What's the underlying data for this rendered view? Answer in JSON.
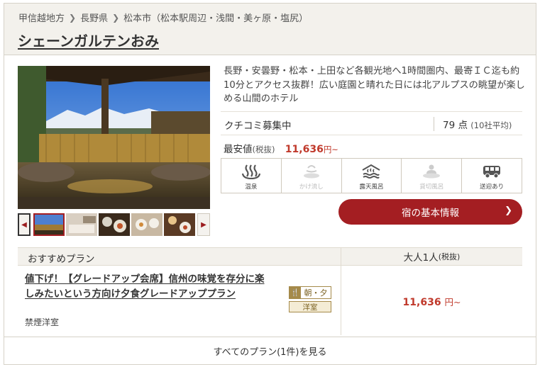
{
  "breadcrumb": {
    "items": [
      "甲信越地方",
      "長野県",
      "松本市（松本駅周辺・浅間・美ヶ原・塩尻）"
    ]
  },
  "hotel": {
    "name": "シェーンガルテンおみ",
    "description": "長野・安曇野・松本・上田など各観光地へ1時間圏内、最寄ＩＣ迄も約10分とアクセス抜群！広い庭園と晴れた日には北アルプスの眺望が楽しめる山間のホテル"
  },
  "review": {
    "label": "クチコミ募集中",
    "score": "79 点",
    "score_note": "(10社平均)"
  },
  "price": {
    "label": "最安値",
    "tax_note": "(税抜)",
    "value": "11,636",
    "unit": "円~"
  },
  "amenities": [
    {
      "label": "温泉",
      "icon": "hot-spring-icon",
      "active": true
    },
    {
      "label": "かけ流し",
      "icon": "flowing-spring-icon",
      "active": false
    },
    {
      "label": "露天風呂",
      "icon": "open-air-bath-icon",
      "active": true
    },
    {
      "label": "貸切風呂",
      "icon": "private-bath-icon",
      "active": false
    },
    {
      "label": "送迎あり",
      "icon": "shuttle-van-icon",
      "active": true
    }
  ],
  "info_button": {
    "label": "宿の基本情報"
  },
  "plans_header": {
    "left": "おすすめプラン",
    "right": "大人1人",
    "right_note": "(税抜)"
  },
  "plan": {
    "name": "値下げ！【グレードアップ会席】信州の味覚を存分に楽しみたいという方向け夕食グレードアッププラン",
    "room": "禁煙洋室",
    "meal": "朝・夕",
    "room_type": "洋室",
    "price": "11,636",
    "unit": "円~"
  },
  "all_plans_link": "すべてのプラン(1件)を見る",
  "colors": {
    "accent": "#a41e22",
    "price": "#c0392b",
    "header_bg": "#f3f1ec"
  }
}
